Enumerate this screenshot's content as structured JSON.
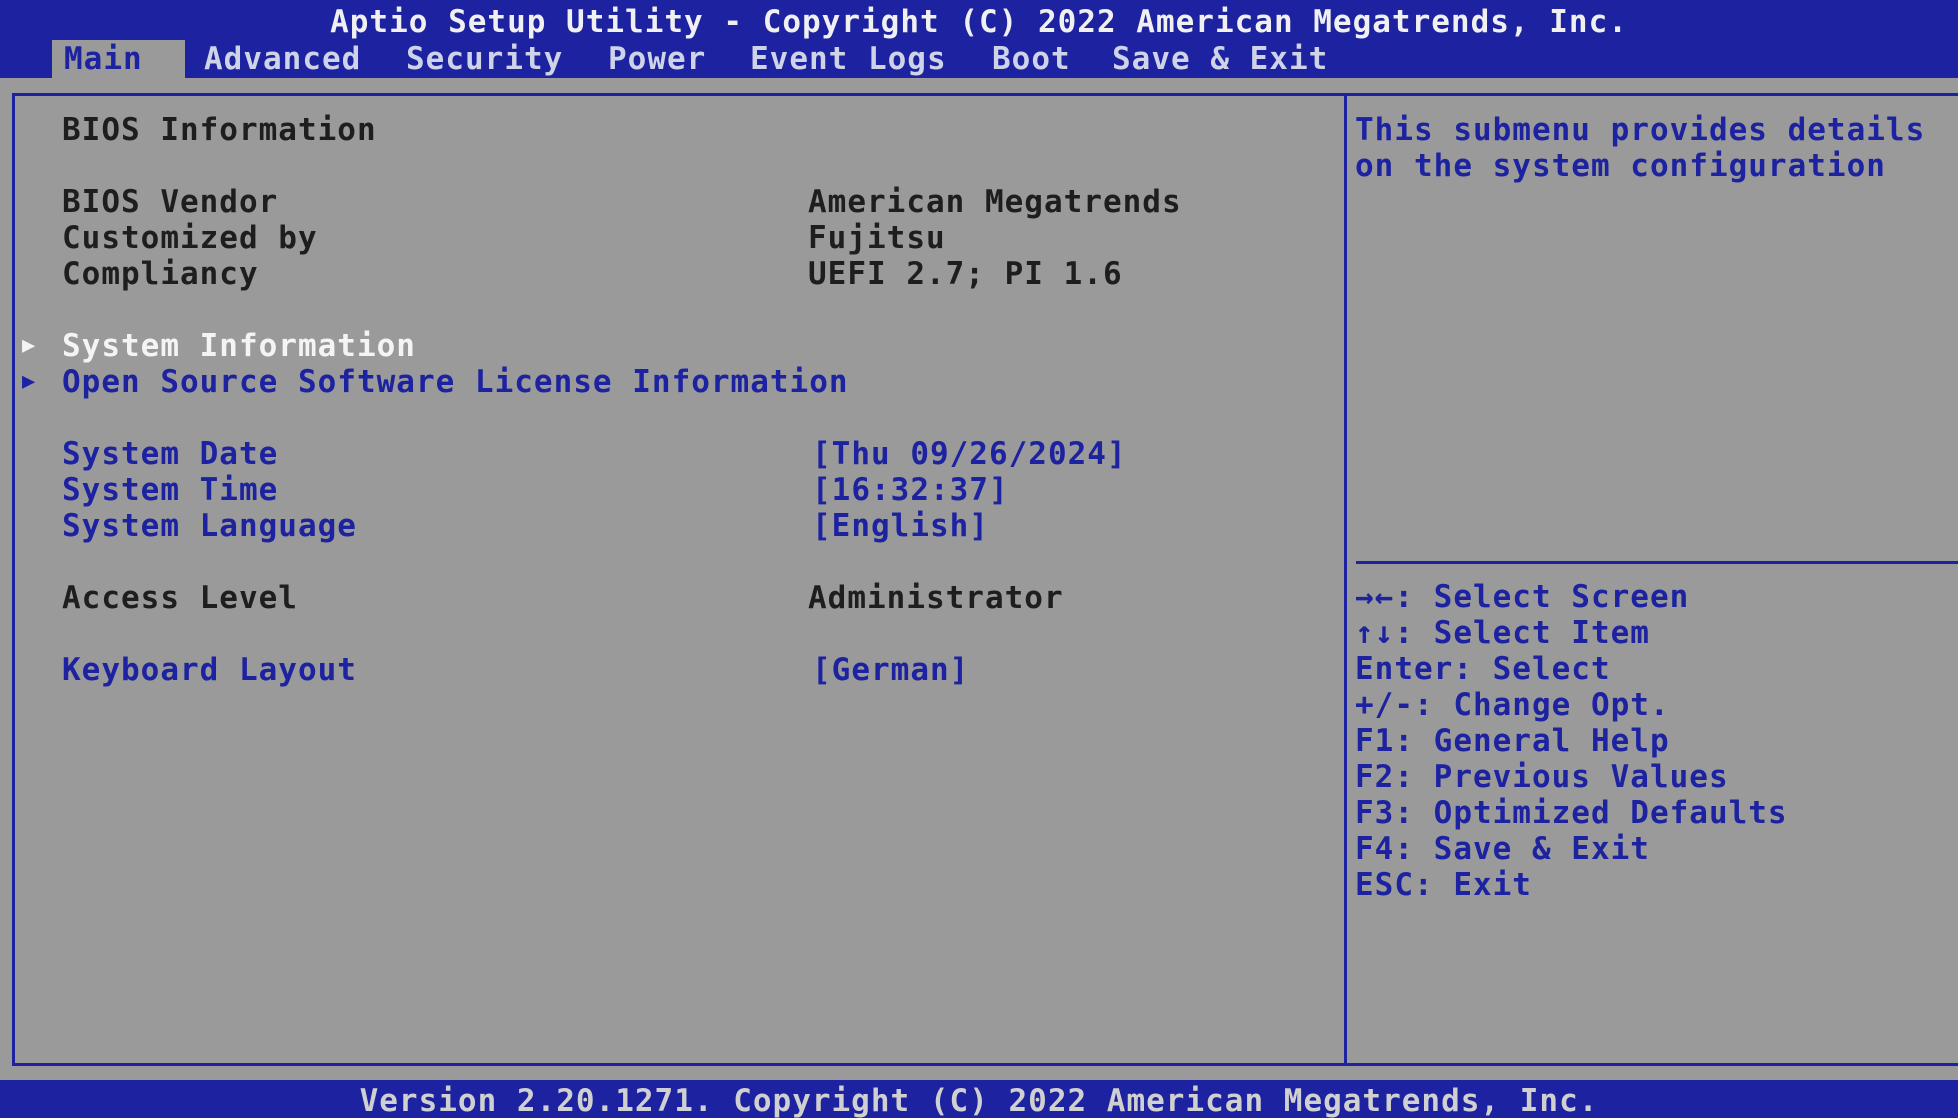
{
  "header": {
    "title": "Aptio Setup Utility - Copyright (C) 2022 American Megatrends, Inc.",
    "tabs": [
      "Main",
      "Advanced",
      "Security",
      "Power",
      "Event Logs",
      "Boot",
      "Save & Exit"
    ],
    "active_tab": "Main"
  },
  "main": {
    "section_title": "BIOS Information",
    "info": [
      {
        "label": "BIOS Vendor",
        "value": "American Megatrends"
      },
      {
        "label": "Customized by",
        "value": "Fujitsu"
      },
      {
        "label": "Compliancy",
        "value": "UEFI 2.7; PI 1.6"
      }
    ],
    "submenus": [
      "System Information",
      "Open Source Software License Information"
    ],
    "settings": [
      {
        "label": "System Date",
        "value": "[Thu 09/26/2024]"
      },
      {
        "label": "System Time",
        "value": "[16:32:37]"
      },
      {
        "label": "System Language",
        "value": "[English]"
      }
    ],
    "access": {
      "label": "Access Level",
      "value": "Administrator"
    },
    "keyboard": {
      "label": "Keyboard Layout",
      "value": "[German]"
    }
  },
  "help": {
    "text": "This submenu provides details\non the system configuration"
  },
  "keys": [
    "→←: Select Screen",
    "↑↓: Select Item",
    "Enter: Select",
    "+/-: Change Opt.",
    "F1: General Help",
    "F2: Previous Values",
    "F3: Optimized Defaults",
    "F4: Save & Exit",
    "ESC: Exit"
  ],
  "footer": {
    "text": "Version 2.20.1271. Copyright (C) 2022 American Megatrends, Inc."
  },
  "colors": {
    "bar": "#1c22a0",
    "background": "#9a9a9a",
    "selected_text": "#f4f4f4"
  },
  "icons": {
    "submenu_arrow": "triangle-right-icon"
  }
}
